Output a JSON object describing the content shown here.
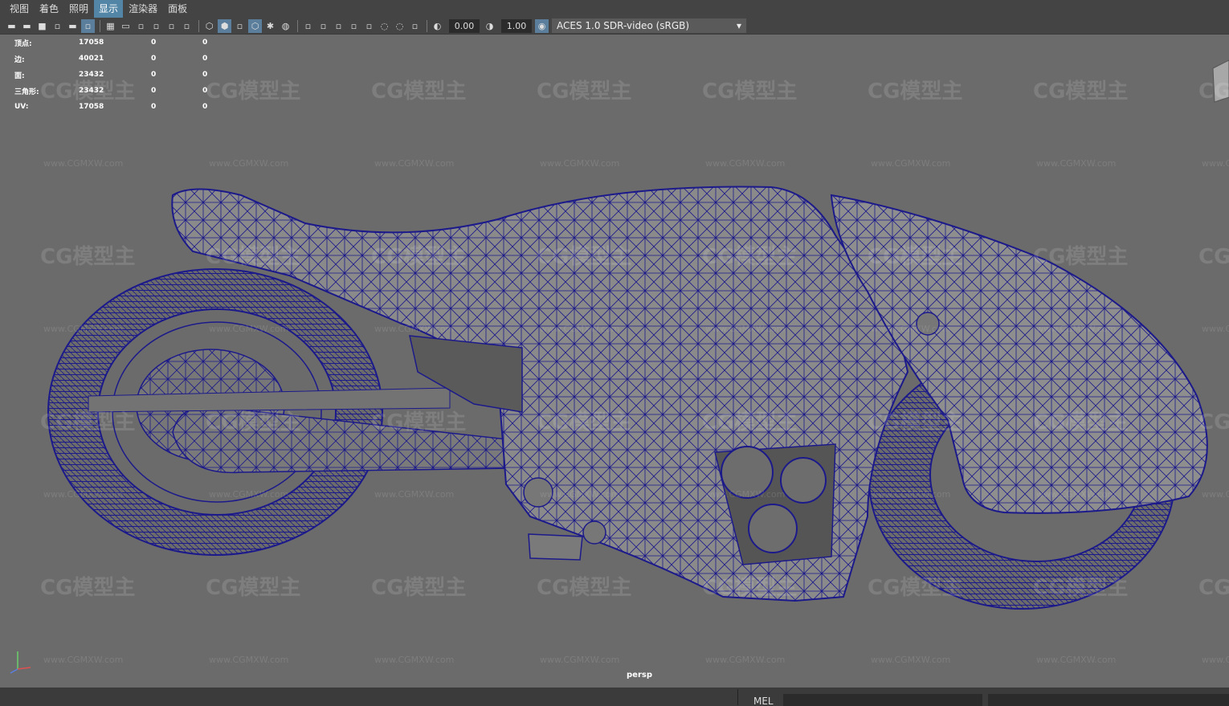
{
  "menu": [
    "视图",
    "着色",
    "照明",
    "显示",
    "渲染器",
    "面板"
  ],
  "menu_active_index": 3,
  "toolbar": {
    "icons_group1": [
      "camera-select-icon",
      "camera-attributes-icon",
      "bookmark-icon",
      "image-plane-icon",
      "move-camera-icon",
      "grease-pencil-icon"
    ],
    "icons_group2": [
      "grid-icon",
      "film-gate-icon",
      "resolution-gate-icon",
      "gate-mask-icon",
      "field-chart-icon",
      "safe-action-icon"
    ],
    "icons_group3": [
      "wireframe-icon",
      "smooth-shade-icon",
      "default-material-icon",
      "wireframe-on-shaded-icon",
      "use-all-lights-icon",
      "shadows-icon"
    ],
    "icons_group4": [
      "screen-space-ao-icon",
      "motion-blur-icon",
      "anti-alias-icon",
      "depth-of-field-icon",
      "isolate-select-icon",
      "xray-icon",
      "xray-joints-icon",
      "backface-icon"
    ],
    "exposure_value": "0.00",
    "gamma_value": "1.00",
    "color_space": "ACES 1.0 SDR-video (sRGB)"
  },
  "hud": [
    {
      "label": "顶点:",
      "v1": "17058",
      "v2": "0",
      "v3": "0"
    },
    {
      "label": "边:",
      "v1": "40021",
      "v2": "0",
      "v3": "0"
    },
    {
      "label": "面:",
      "v1": "23432",
      "v2": "0",
      "v3": "0"
    },
    {
      "label": "三角形:",
      "v1": "23432",
      "v2": "0",
      "v3": "0"
    },
    {
      "label": "UV:",
      "v1": "17058",
      "v2": "0",
      "v3": "0"
    }
  ],
  "camera_label": "persp",
  "watermark_logo": "CG模型主",
  "watermark_url": "www.CGMXW.com",
  "status": {
    "mel_label": "MEL"
  },
  "colors": {
    "viewport_bg": "#6b6b6b",
    "wireframe": "#1c1a8a",
    "menu_active": "#5285a6",
    "ui_bg": "#444444"
  }
}
